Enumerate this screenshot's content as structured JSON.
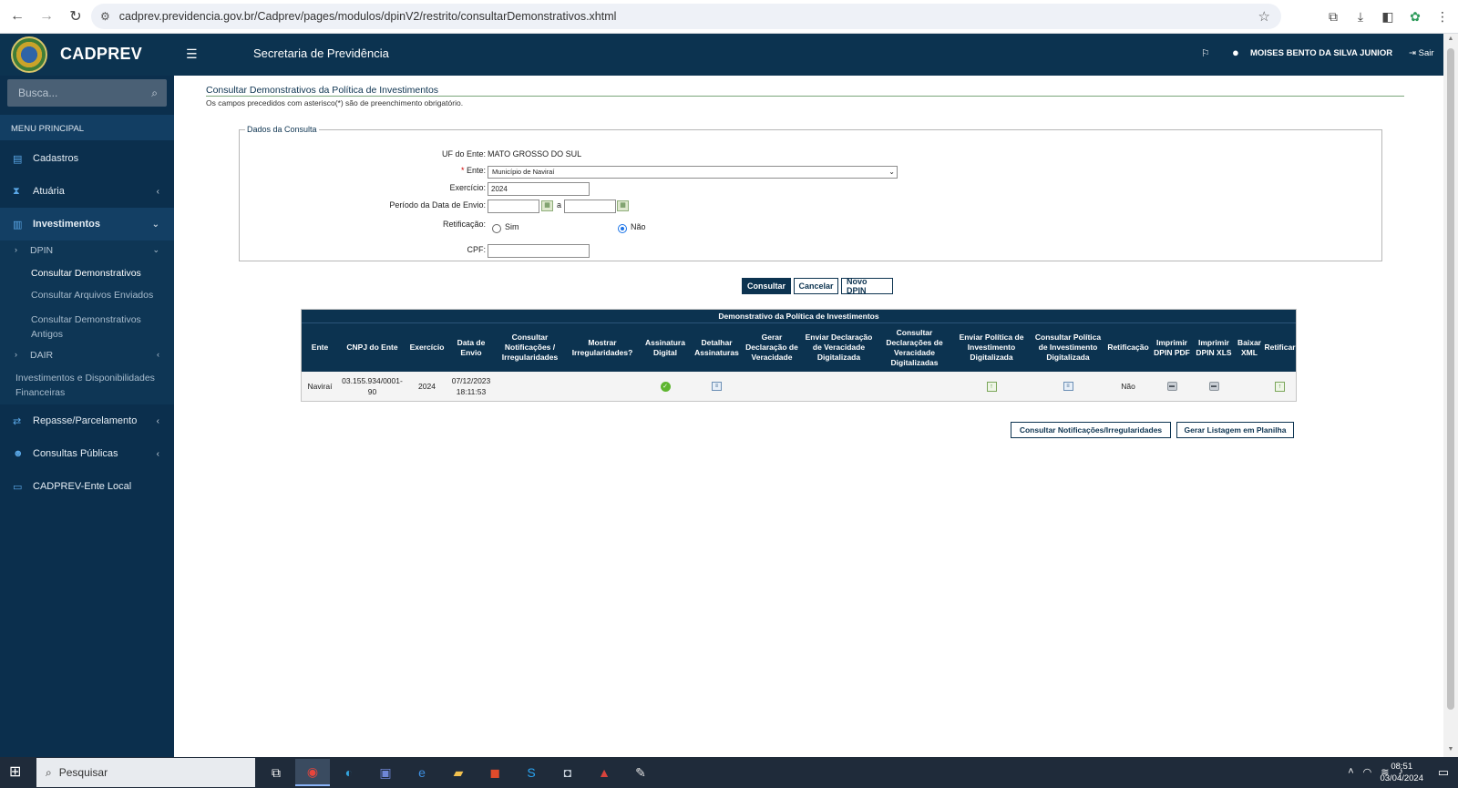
{
  "browser": {
    "url": "cadprev.previdencia.gov.br/Cadprev/pages/modulos/dpinV2/restrito/consultarDemonstrativos.xhtml"
  },
  "header": {
    "app_name": "CADPREV",
    "section_title": "Secretaria de Previdência",
    "user_name": "MOISES BENTO DA SILVA JUNIOR",
    "logout_label": "Sair"
  },
  "sidebar": {
    "search_placeholder": "Busca...",
    "menu_heading": "MENU PRINCIPAL",
    "items": [
      {
        "label": "Cadastros",
        "icon": "file-icon"
      },
      {
        "label": "Atuária",
        "icon": "hourglass-icon"
      },
      {
        "label": "Investimentos",
        "icon": "bar-chart-icon"
      },
      {
        "label": "Repasse/Parcelamento",
        "icon": "exchange-icon"
      },
      {
        "label": "Consultas Públicas",
        "icon": "users-icon"
      },
      {
        "label": "CADPREV-Ente Local",
        "icon": "monitor-icon"
      }
    ],
    "submenu": {
      "dpin": "DPIN",
      "dpin_items": [
        "Consultar Demonstrativos",
        "Consultar Arquivos Enviados",
        "Consultar Demonstrativos Antigos"
      ],
      "dair": "DAIR",
      "other": "Investimentos e Disponibilidades Financeiras"
    }
  },
  "page": {
    "title": "Consultar Demonstrativos da Política de Investimentos",
    "subtitle": "Os campos precedidos com asterisco(*) são de preenchimento obrigatório."
  },
  "form": {
    "legend": "Dados da Consulta",
    "uf_label": "UF do Ente:",
    "uf_value": "MATO GROSSO DO SUL",
    "ente_label": "Ente:",
    "ente_required": "*",
    "ente_value": "Município de Naviraí",
    "exercicio_label": "Exercício:",
    "exercicio_value": "2024",
    "periodo_label": "Período da Data de Envio:",
    "periodo_sep": "a",
    "retificacao_label": "Retificação:",
    "retificacao_sim": "Sim",
    "retificacao_nao": "Não",
    "retificacao_selected": "Não",
    "cpf_label": "CPF:"
  },
  "actions": {
    "consultar": "Consultar",
    "cancelar": "Cancelar",
    "novo_dpin": "Novo DPIN",
    "consultar_notificacoes": "Consultar Notificações/Irregularidades",
    "gerar_listagem": "Gerar Listagem em Planilha"
  },
  "table": {
    "caption": "Demonstrativo da Política de Investimentos",
    "columns": [
      "Ente",
      "CNPJ do Ente",
      "Exercício",
      "Data de Envio",
      "Consultar Notificações / Irregularidades",
      "Mostrar Irregularidades?",
      "Assinatura Digital",
      "Detalhar Assinaturas",
      "Gerar Declaração de Veracidade",
      "Enviar Declaração de Veracidade Digitalizada",
      "Consultar Declarações de Veracidade Digitalizadas",
      "Enviar Política de Investimento Digitalizada",
      "Consultar Política de Investimento Digitalizada",
      "Retificação",
      "Imprimir DPIN PDF",
      "Imprimir DPIN XLS",
      "Baixar XML",
      "Retificar"
    ],
    "rows": [
      {
        "ente": "Naviraí",
        "cnpj": "03.155.934/0001-90",
        "exercicio": "2024",
        "data_envio": "07/12/2023 18:11:53",
        "retificacao": "Não"
      }
    ]
  },
  "taskbar": {
    "search_label": "Pesquisar",
    "time": "08:51",
    "date": "03/04/2024"
  }
}
